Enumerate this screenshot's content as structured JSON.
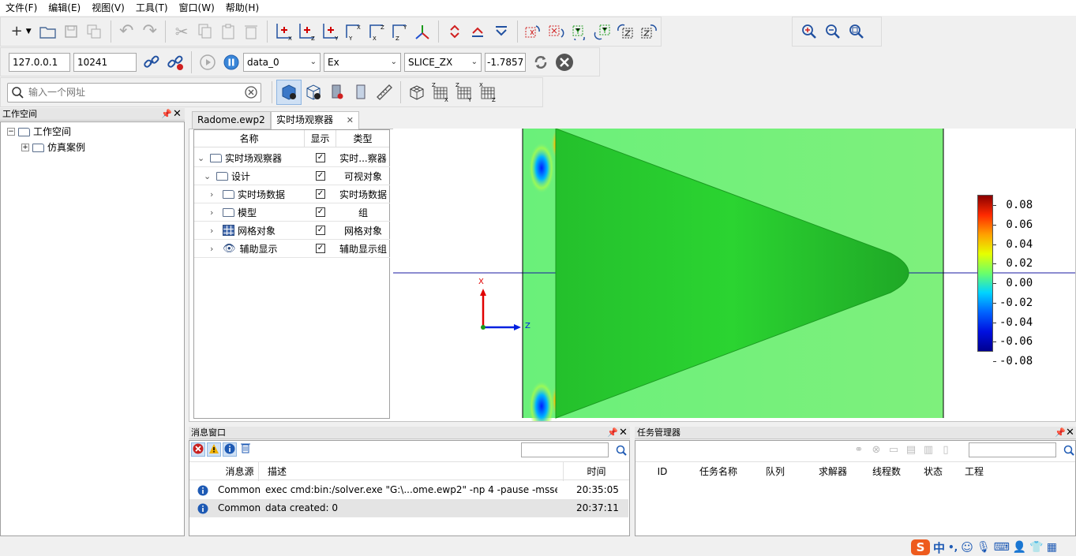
{
  "menu": [
    "文件(F)",
    "编辑(E)",
    "视图(V)",
    "工具(T)",
    "窗口(W)",
    "帮助(H)"
  ],
  "connection": {
    "ip": "127.0.0.1",
    "port": "10241",
    "dataset": "data_0",
    "component": "Ex",
    "slice": "SLICE_ZX",
    "slice_value": "-1.7857"
  },
  "search": {
    "placeholder": "输入一个网址"
  },
  "workspace": {
    "title": "工作空间",
    "root": "工作空间",
    "child": "仿真案例"
  },
  "tabs": [
    {
      "label": "Radome.ewp2"
    },
    {
      "label": "实时场观察器"
    }
  ],
  "tree_table": {
    "headers": [
      "名称",
      "显示",
      "类型"
    ],
    "rows": [
      {
        "name": "实时场观察器",
        "type": "实时...察器"
      },
      {
        "name": "设计",
        "type": "可视对象"
      },
      {
        "name": "实时场数据",
        "type": "实时场数据"
      },
      {
        "name": "模型",
        "type": "组"
      },
      {
        "name": "网格对象",
        "type": "网格对象"
      },
      {
        "name": "辅助显示",
        "type": "辅助显示组"
      }
    ]
  },
  "viewport": {
    "axis_x": "X",
    "axis_z": "Z",
    "colorbar_ticks": [
      "0.08",
      "0.06",
      "0.04",
      "0.02",
      "0.00",
      "-0.02",
      "-0.04",
      "-0.06",
      "-0.08"
    ],
    "colorbar_colors": [
      "#8a0000",
      "#ff2a00",
      "#ffa000",
      "#e6ff00",
      "#6aff6a",
      "#00d4ff",
      "#0064ff",
      "#0010e0",
      "#000090"
    ]
  },
  "messages": {
    "title": "消息窗口",
    "headers": {
      "source": "消息源",
      "desc": "描述",
      "time": "时间"
    },
    "rows": [
      {
        "source": "Common",
        "desc": "exec cmd:bin:/solver.exe \"G:\\...ome.ewp2\" -np 4 -pause  -msse",
        "time": "20:35:05"
      },
      {
        "source": "Common",
        "desc": "data created: 0",
        "time": "20:37:11"
      }
    ]
  },
  "tasks": {
    "title": "任务管理器",
    "headers": [
      "ID",
      "任务名称",
      "队列",
      "求解器",
      "线程数",
      "状态",
      "工程"
    ]
  },
  "tray": {
    "ime": "中",
    "punct": "•,"
  }
}
